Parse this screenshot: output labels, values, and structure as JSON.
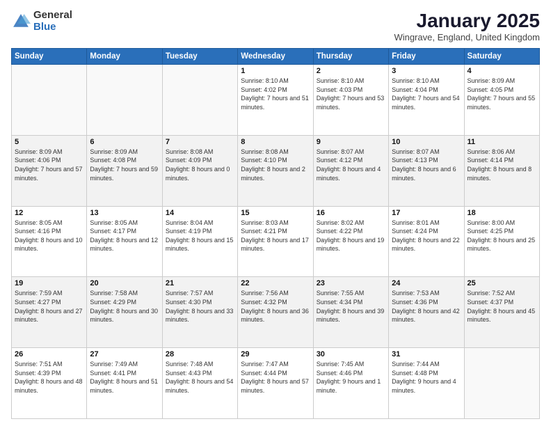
{
  "logo": {
    "general": "General",
    "blue": "Blue"
  },
  "header": {
    "month": "January 2025",
    "location": "Wingrave, England, United Kingdom"
  },
  "weekdays": [
    "Sunday",
    "Monday",
    "Tuesday",
    "Wednesday",
    "Thursday",
    "Friday",
    "Saturday"
  ],
  "weeks": [
    [
      {
        "day": "",
        "sunrise": "",
        "sunset": "",
        "daylight": "",
        "empty": true
      },
      {
        "day": "",
        "sunrise": "",
        "sunset": "",
        "daylight": "",
        "empty": true
      },
      {
        "day": "",
        "sunrise": "",
        "sunset": "",
        "daylight": "",
        "empty": true
      },
      {
        "day": "1",
        "sunrise": "Sunrise: 8:10 AM",
        "sunset": "Sunset: 4:02 PM",
        "daylight": "Daylight: 7 hours and 51 minutes."
      },
      {
        "day": "2",
        "sunrise": "Sunrise: 8:10 AM",
        "sunset": "Sunset: 4:03 PM",
        "daylight": "Daylight: 7 hours and 53 minutes."
      },
      {
        "day": "3",
        "sunrise": "Sunrise: 8:10 AM",
        "sunset": "Sunset: 4:04 PM",
        "daylight": "Daylight: 7 hours and 54 minutes."
      },
      {
        "day": "4",
        "sunrise": "Sunrise: 8:09 AM",
        "sunset": "Sunset: 4:05 PM",
        "daylight": "Daylight: 7 hours and 55 minutes."
      }
    ],
    [
      {
        "day": "5",
        "sunrise": "Sunrise: 8:09 AM",
        "sunset": "Sunset: 4:06 PM",
        "daylight": "Daylight: 7 hours and 57 minutes."
      },
      {
        "day": "6",
        "sunrise": "Sunrise: 8:09 AM",
        "sunset": "Sunset: 4:08 PM",
        "daylight": "Daylight: 7 hours and 59 minutes."
      },
      {
        "day": "7",
        "sunrise": "Sunrise: 8:08 AM",
        "sunset": "Sunset: 4:09 PM",
        "daylight": "Daylight: 8 hours and 0 minutes."
      },
      {
        "day": "8",
        "sunrise": "Sunrise: 8:08 AM",
        "sunset": "Sunset: 4:10 PM",
        "daylight": "Daylight: 8 hours and 2 minutes."
      },
      {
        "day": "9",
        "sunrise": "Sunrise: 8:07 AM",
        "sunset": "Sunset: 4:12 PM",
        "daylight": "Daylight: 8 hours and 4 minutes."
      },
      {
        "day": "10",
        "sunrise": "Sunrise: 8:07 AM",
        "sunset": "Sunset: 4:13 PM",
        "daylight": "Daylight: 8 hours and 6 minutes."
      },
      {
        "day": "11",
        "sunrise": "Sunrise: 8:06 AM",
        "sunset": "Sunset: 4:14 PM",
        "daylight": "Daylight: 8 hours and 8 minutes."
      }
    ],
    [
      {
        "day": "12",
        "sunrise": "Sunrise: 8:05 AM",
        "sunset": "Sunset: 4:16 PM",
        "daylight": "Daylight: 8 hours and 10 minutes."
      },
      {
        "day": "13",
        "sunrise": "Sunrise: 8:05 AM",
        "sunset": "Sunset: 4:17 PM",
        "daylight": "Daylight: 8 hours and 12 minutes."
      },
      {
        "day": "14",
        "sunrise": "Sunrise: 8:04 AM",
        "sunset": "Sunset: 4:19 PM",
        "daylight": "Daylight: 8 hours and 15 minutes."
      },
      {
        "day": "15",
        "sunrise": "Sunrise: 8:03 AM",
        "sunset": "Sunset: 4:21 PM",
        "daylight": "Daylight: 8 hours and 17 minutes."
      },
      {
        "day": "16",
        "sunrise": "Sunrise: 8:02 AM",
        "sunset": "Sunset: 4:22 PM",
        "daylight": "Daylight: 8 hours and 19 minutes."
      },
      {
        "day": "17",
        "sunrise": "Sunrise: 8:01 AM",
        "sunset": "Sunset: 4:24 PM",
        "daylight": "Daylight: 8 hours and 22 minutes."
      },
      {
        "day": "18",
        "sunrise": "Sunrise: 8:00 AM",
        "sunset": "Sunset: 4:25 PM",
        "daylight": "Daylight: 8 hours and 25 minutes."
      }
    ],
    [
      {
        "day": "19",
        "sunrise": "Sunrise: 7:59 AM",
        "sunset": "Sunset: 4:27 PM",
        "daylight": "Daylight: 8 hours and 27 minutes."
      },
      {
        "day": "20",
        "sunrise": "Sunrise: 7:58 AM",
        "sunset": "Sunset: 4:29 PM",
        "daylight": "Daylight: 8 hours and 30 minutes."
      },
      {
        "day": "21",
        "sunrise": "Sunrise: 7:57 AM",
        "sunset": "Sunset: 4:30 PM",
        "daylight": "Daylight: 8 hours and 33 minutes."
      },
      {
        "day": "22",
        "sunrise": "Sunrise: 7:56 AM",
        "sunset": "Sunset: 4:32 PM",
        "daylight": "Daylight: 8 hours and 36 minutes."
      },
      {
        "day": "23",
        "sunrise": "Sunrise: 7:55 AM",
        "sunset": "Sunset: 4:34 PM",
        "daylight": "Daylight: 8 hours and 39 minutes."
      },
      {
        "day": "24",
        "sunrise": "Sunrise: 7:53 AM",
        "sunset": "Sunset: 4:36 PM",
        "daylight": "Daylight: 8 hours and 42 minutes."
      },
      {
        "day": "25",
        "sunrise": "Sunrise: 7:52 AM",
        "sunset": "Sunset: 4:37 PM",
        "daylight": "Daylight: 8 hours and 45 minutes."
      }
    ],
    [
      {
        "day": "26",
        "sunrise": "Sunrise: 7:51 AM",
        "sunset": "Sunset: 4:39 PM",
        "daylight": "Daylight: 8 hours and 48 minutes."
      },
      {
        "day": "27",
        "sunrise": "Sunrise: 7:49 AM",
        "sunset": "Sunset: 4:41 PM",
        "daylight": "Daylight: 8 hours and 51 minutes."
      },
      {
        "day": "28",
        "sunrise": "Sunrise: 7:48 AM",
        "sunset": "Sunset: 4:43 PM",
        "daylight": "Daylight: 8 hours and 54 minutes."
      },
      {
        "day": "29",
        "sunrise": "Sunrise: 7:47 AM",
        "sunset": "Sunset: 4:44 PM",
        "daylight": "Daylight: 8 hours and 57 minutes."
      },
      {
        "day": "30",
        "sunrise": "Sunrise: 7:45 AM",
        "sunset": "Sunset: 4:46 PM",
        "daylight": "Daylight: 9 hours and 1 minute."
      },
      {
        "day": "31",
        "sunrise": "Sunrise: 7:44 AM",
        "sunset": "Sunset: 4:48 PM",
        "daylight": "Daylight: 9 hours and 4 minutes."
      },
      {
        "day": "",
        "sunrise": "",
        "sunset": "",
        "daylight": "",
        "empty": true
      }
    ]
  ]
}
